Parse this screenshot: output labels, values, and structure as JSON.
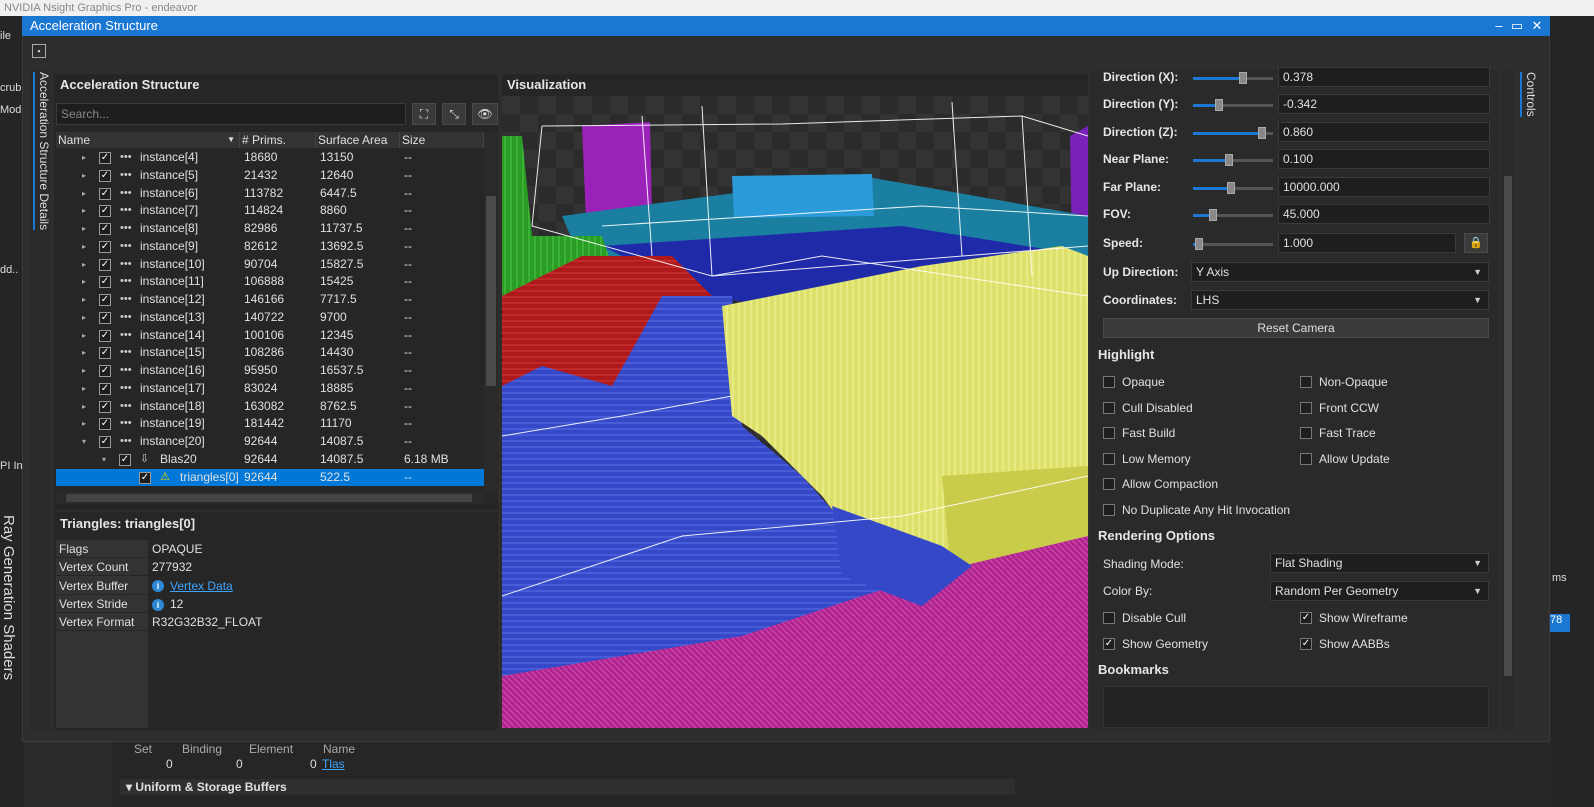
{
  "bg": {
    "app_title": "NVIDIA Nsight Graphics Pro - endeavor",
    "left_labels": [
      "ile",
      "crub",
      "Mod",
      "dd..",
      "PI In"
    ],
    "vertical_text": "Ray Generation Shaders",
    "bottom_headers": [
      "Set",
      "Binding",
      "Element",
      "Name"
    ],
    "bottom_values": [
      "0",
      "0",
      "0"
    ],
    "bottom_link": "Tlas",
    "uniform_label": "Uniform & Storage Buffers",
    "right_labels": [
      "ms",
      "78"
    ]
  },
  "dialog": {
    "title": "Acceleration Structure",
    "left_tab": "Acceleration Structure Details",
    "right_tab": "Controls"
  },
  "as_panel": {
    "title": "Acceleration Structure",
    "search_placeholder": "Search...",
    "columns": [
      "Name",
      "# Prims.",
      "Surface Area",
      "Size"
    ],
    "rows": [
      {
        "name": "instance[4]",
        "prims": "18680",
        "surf": "13150",
        "size": "--"
      },
      {
        "name": "instance[5]",
        "prims": "21432",
        "surf": "12640",
        "size": "--"
      },
      {
        "name": "instance[6]",
        "prims": "113782",
        "surf": "6447.5",
        "size": "--"
      },
      {
        "name": "instance[7]",
        "prims": "114824",
        "surf": "8860",
        "size": "--"
      },
      {
        "name": "instance[8]",
        "prims": "82986",
        "surf": "11737.5",
        "size": "--"
      },
      {
        "name": "instance[9]",
        "prims": "82612",
        "surf": "13692.5",
        "size": "--"
      },
      {
        "name": "instance[10]",
        "prims": "90704",
        "surf": "15827.5",
        "size": "--"
      },
      {
        "name": "instance[11]",
        "prims": "106888",
        "surf": "15425",
        "size": "--"
      },
      {
        "name": "instance[12]",
        "prims": "146166",
        "surf": "7717.5",
        "size": "--"
      },
      {
        "name": "instance[13]",
        "prims": "140722",
        "surf": "9700",
        "size": "--"
      },
      {
        "name": "instance[14]",
        "prims": "100106",
        "surf": "12345",
        "size": "--"
      },
      {
        "name": "instance[15]",
        "prims": "108286",
        "surf": "14430",
        "size": "--"
      },
      {
        "name": "instance[16]",
        "prims": "95950",
        "surf": "16537.5",
        "size": "--"
      },
      {
        "name": "instance[17]",
        "prims": "83024",
        "surf": "18885",
        "size": "--"
      },
      {
        "name": "instance[18]",
        "prims": "163082",
        "surf": "8762.5",
        "size": "--"
      },
      {
        "name": "instance[19]",
        "prims": "181442",
        "surf": "11170",
        "size": "--"
      },
      {
        "name": "instance[20]",
        "prims": "92644",
        "surf": "14087.5",
        "size": "--"
      },
      {
        "name": "Blas20",
        "prims": "92644",
        "surf": "14087.5",
        "size": "6.18 MB"
      },
      {
        "name": "triangles[0]",
        "prims": "92644",
        "surf": "522.5",
        "size": "--"
      }
    ]
  },
  "tri_panel": {
    "title": "Triangles: triangles[0]",
    "props": [
      {
        "key": "Flags",
        "val": "OPAQUE"
      },
      {
        "key": "Vertex Count",
        "val": "277932"
      },
      {
        "key": "Vertex Buffer",
        "val": "Vertex Data"
      },
      {
        "key": "Vertex Stride",
        "val": "12"
      },
      {
        "key": "Vertex Format",
        "val": "R32G32B32_FLOAT"
      }
    ]
  },
  "viz": {
    "title": "Visualization"
  },
  "controls": {
    "camera": [
      {
        "label": "Direction (X):",
        "value": "0.378",
        "slider": 0.62
      },
      {
        "label": "Direction (Y):",
        "value": "-0.342",
        "slider": 0.33
      },
      {
        "label": "Direction (Z):",
        "value": "0.860",
        "slider": 0.86
      },
      {
        "label": "Near Plane:",
        "value": "0.100",
        "slider": 0.45
      },
      {
        "label": "Far Plane:",
        "value": "10000.000",
        "slider": 0.48
      },
      {
        "label": "FOV:",
        "value": "45.000",
        "slider": 0.25
      },
      {
        "label": "Speed:",
        "value": "1.000",
        "slider": 0.08
      }
    ],
    "up_direction_label": "Up Direction:",
    "up_direction": "Y Axis",
    "coordinates_label": "Coordinates:",
    "coordinates": "LHS",
    "reset_camera": "Reset Camera",
    "highlight_title": "Highlight",
    "highlight": [
      {
        "label": "Opaque",
        "checked": false
      },
      {
        "label": "Non-Opaque",
        "checked": false
      },
      {
        "label": "Cull Disabled",
        "checked": false
      },
      {
        "label": "Front CCW",
        "checked": false
      },
      {
        "label": "Fast Build",
        "checked": false
      },
      {
        "label": "Fast Trace",
        "checked": false
      },
      {
        "label": "Low Memory",
        "checked": false
      },
      {
        "label": "Allow Update",
        "checked": false
      },
      {
        "label": "Allow Compaction",
        "checked": false
      },
      {
        "label": "No Duplicate Any Hit Invocation",
        "checked": false
      }
    ],
    "rendering_title": "Rendering Options",
    "shading_label": "Shading Mode:",
    "shading_value": "Flat Shading",
    "colorby_label": "Color By:",
    "colorby_value": "Random Per Geometry",
    "render_opts": [
      {
        "label": "Disable Cull",
        "checked": false
      },
      {
        "label": "Show Wireframe",
        "checked": true
      },
      {
        "label": "Show Geometry",
        "checked": true
      },
      {
        "label": "Show AABBs",
        "checked": true
      }
    ],
    "bookmarks_title": "Bookmarks"
  }
}
